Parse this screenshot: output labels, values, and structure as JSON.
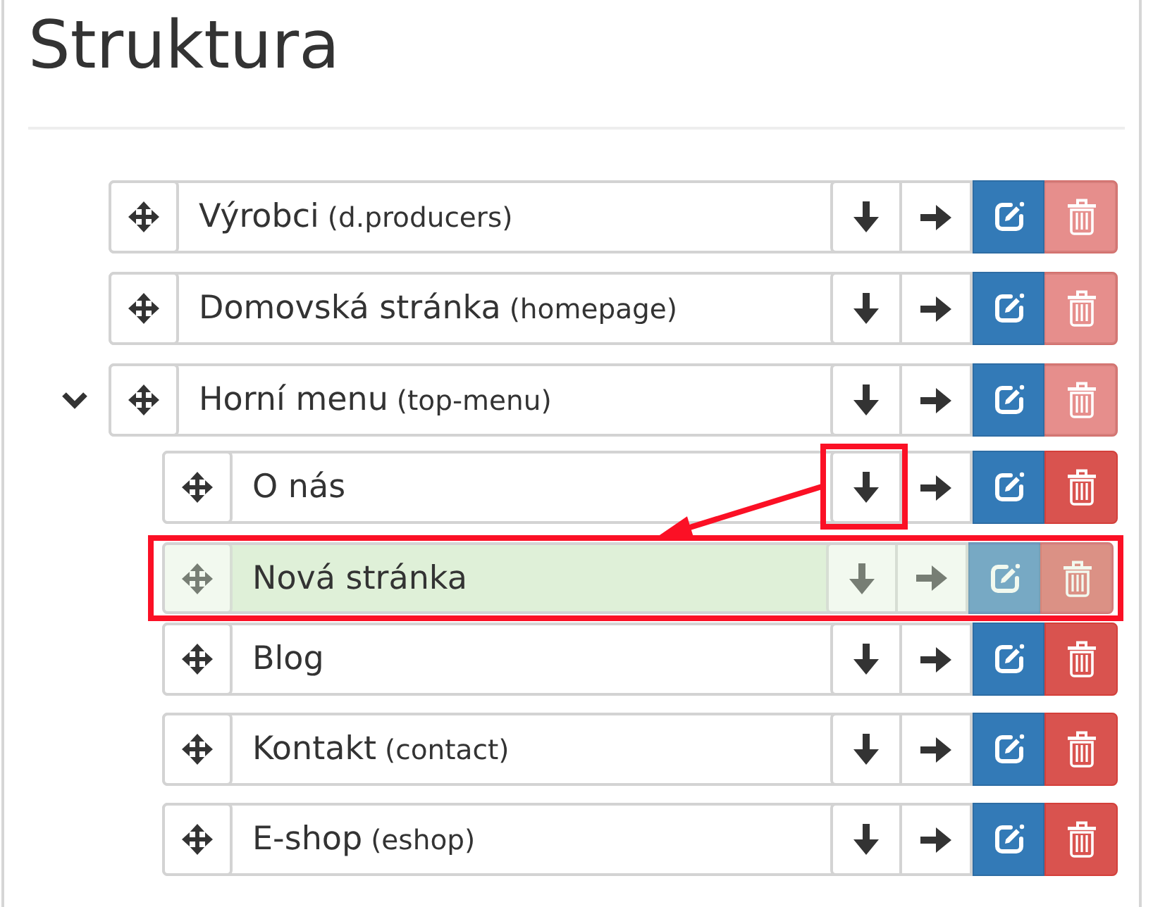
{
  "title": "Struktura",
  "tree": [
    {
      "name": "Výrobci",
      "slug": "(d.producers)",
      "dragging": false,
      "delete_disabled": true
    },
    {
      "name": "Domovská stránka",
      "slug": "(homepage)",
      "dragging": false,
      "delete_disabled": true
    },
    {
      "name": "Horní menu",
      "slug": "(top-menu)",
      "dragging": false,
      "delete_disabled": true,
      "expanded": true,
      "children": [
        {
          "name": "O nás",
          "dragging": false,
          "delete_disabled": false,
          "down_button_highlighted": true
        },
        {
          "name": "Nová stránka",
          "dragging": true,
          "delete_disabled": false,
          "row_highlighted": true
        },
        {
          "name": "Blog",
          "dragging": false,
          "delete_disabled": false
        },
        {
          "name": "Kontakt",
          "slug": "(contact)",
          "dragging": false,
          "delete_disabled": false
        },
        {
          "name": "E-shop",
          "slug": "(eshop)",
          "dragging": false,
          "delete_disabled": false
        }
      ]
    }
  ],
  "annotation_arrow": true
}
